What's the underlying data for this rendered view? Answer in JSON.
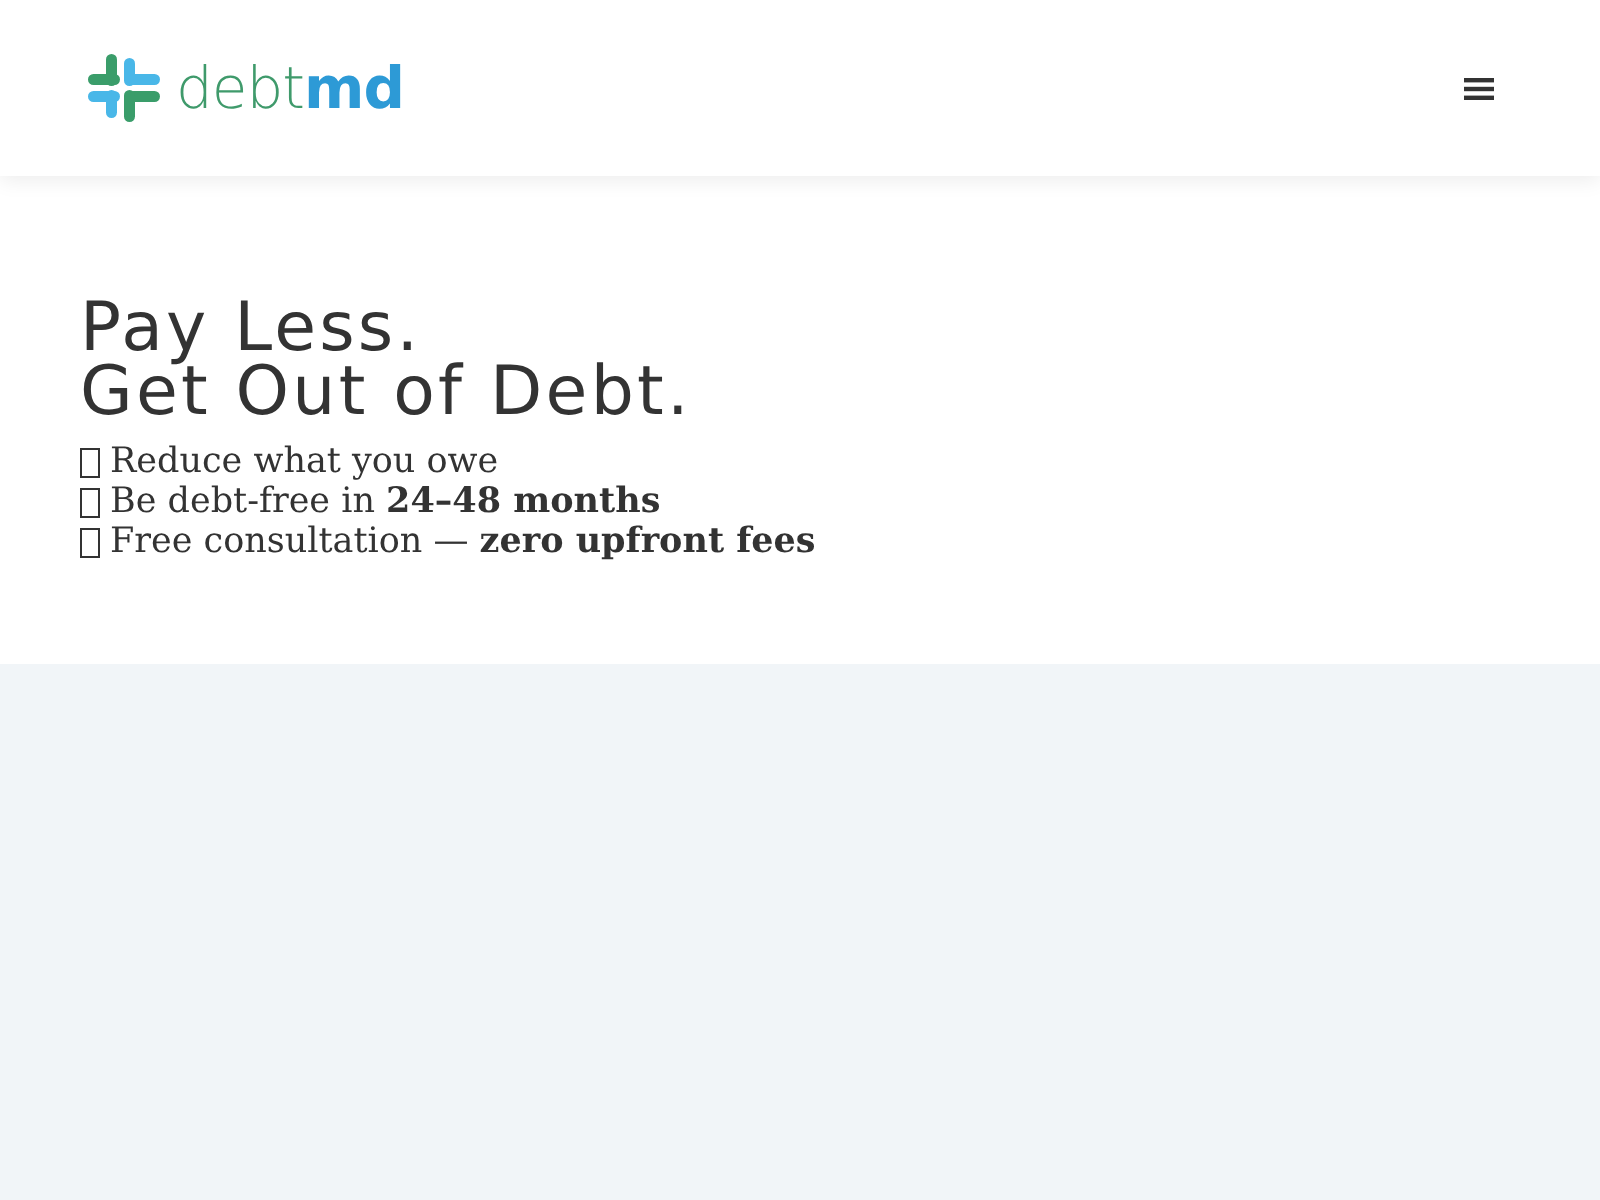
{
  "header": {
    "logo": "debt**md**",
    "menu_button": true
  },
  "hero": {
    "headline": [
      "Pay Less.",
      "Get Out of Debt."
    ],
    "bullets": [
      "Reduce what you owe",
      "Be debt-free in **24–48 months**",
      "Free consultation — **zero upfront fees**"
    ]
  }
}
